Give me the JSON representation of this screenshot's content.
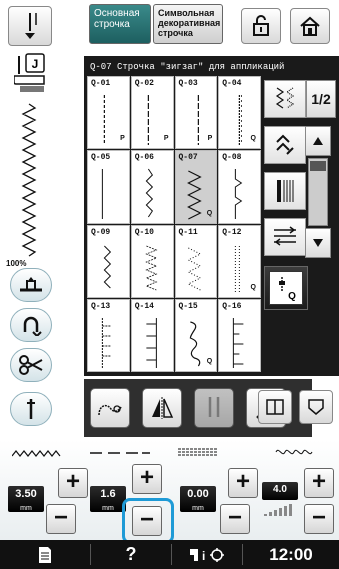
{
  "tabs": {
    "basic_line1": "Основная",
    "basic_line2": "строчка",
    "decor_line1": "Символьная",
    "decor_line2": "декоративная",
    "decor_line3": "строчка"
  },
  "panel": {
    "title": "Q-07 Строчка \"зигзаг\" для аппликаций",
    "cells": [
      {
        "code": "Q-01",
        "foot": "P"
      },
      {
        "code": "Q-02",
        "foot": "P"
      },
      {
        "code": "Q-03",
        "foot": "P"
      },
      {
        "code": "Q-04",
        "foot": "Q"
      },
      {
        "code": "Q-05",
        "foot": ""
      },
      {
        "code": "Q-06",
        "foot": ""
      },
      {
        "code": "Q-07",
        "foot": "Q"
      },
      {
        "code": "Q-08",
        "foot": ""
      },
      {
        "code": "Q-09",
        "foot": ""
      },
      {
        "code": "Q-10",
        "foot": ""
      },
      {
        "code": "Q-11",
        "foot": ""
      },
      {
        "code": "Q-12",
        "foot": "Q"
      },
      {
        "code": "Q-13",
        "foot": ""
      },
      {
        "code": "Q-14",
        "foot": ""
      },
      {
        "code": "Q-15",
        "foot": "Q"
      },
      {
        "code": "Q-16",
        "foot": ""
      }
    ],
    "page_indicator": "1/2",
    "selected_code": "Q-07"
  },
  "zoom": "100%",
  "adjust": {
    "width_value": "3.50",
    "width_unit": "mm",
    "length_value": "1.6",
    "length_unit": "mm",
    "third_value": "0.00",
    "third_unit": "mm",
    "tension_value": "4.0"
  },
  "status": {
    "question": "?",
    "time": "12:00"
  },
  "colors": {
    "accent": "#1e9ad6",
    "tab_active": "#2a7778"
  }
}
